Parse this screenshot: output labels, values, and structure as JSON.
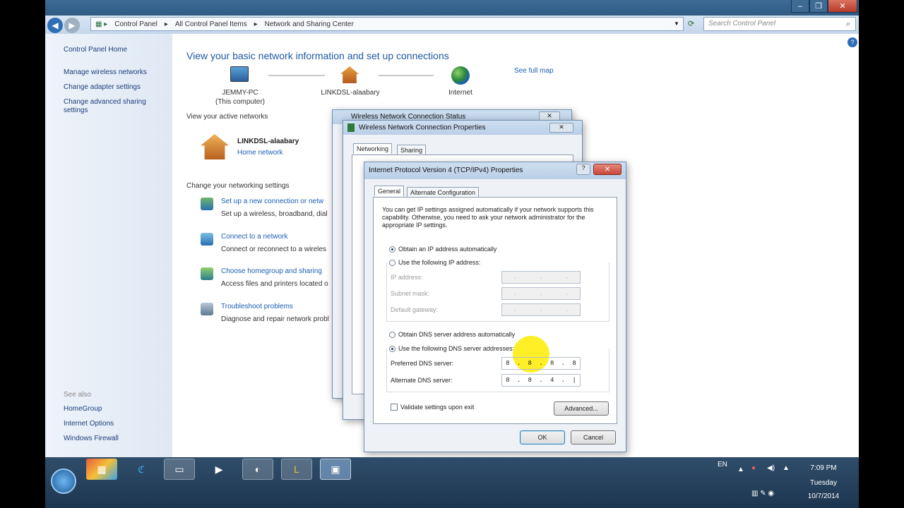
{
  "address_bar": {
    "breadcrumb": [
      "Control Panel",
      "All Control Panel Items",
      "Network and Sharing Center"
    ],
    "search_placeholder": "Search Control Panel"
  },
  "left_pane": {
    "home": "Control Panel Home",
    "links": [
      "Manage wireless networks",
      "Change adapter settings",
      "Change advanced sharing settings"
    ],
    "see_also_head": "See also",
    "see_also": [
      "HomeGroup",
      "Internet Options",
      "Windows Firewall"
    ]
  },
  "main": {
    "title": "View your basic network information and set up connections",
    "map": {
      "computer_name": "JEMMY-PC",
      "computer_sub": "(This computer)",
      "network_name": "LINKDSL-alaabary",
      "internet": "Internet",
      "see_full_map": "See full map"
    },
    "active_networks_head": "View your active networks",
    "active_network": {
      "name": "LINKDSL-alaabary",
      "type": "Home network"
    },
    "change_settings_head": "Change your networking settings",
    "tasks": [
      {
        "title": "Set up a new connection or netw",
        "sub": "Set up a wireless, broadband, dial"
      },
      {
        "title": "Connect to a network",
        "sub": "Connect or reconnect to a wireles"
      },
      {
        "title": "Choose homegroup and sharing",
        "sub": "Access files and printers located o"
      },
      {
        "title": "Troubleshoot problems",
        "sub": "Diagnose and repair network probl"
      }
    ]
  },
  "status_dialog": {
    "title": "Wireless Network Connection Status"
  },
  "properties_dialog": {
    "title": "Wireless Network Connection Properties",
    "tabs": [
      "Networking",
      "Sharing"
    ]
  },
  "ipv4_dialog": {
    "title": "Internet Protocol Version 4 (TCP/IPv4) Properties",
    "tabs": [
      "General",
      "Alternate Configuration"
    ],
    "intro": "You can get IP settings assigned automatically if your network supports this capability. Otherwise, you need to ask your network administrator for the appropriate IP settings.",
    "ip_auto": "Obtain an IP address automatically",
    "ip_manual": "Use the following IP address:",
    "ip_address_label": "IP address:",
    "subnet_label": "Subnet mask:",
    "gateway_label": "Default gateway:",
    "dns_auto": "Obtain DNS server address automatically",
    "dns_manual": "Use the following DNS server addresses:",
    "preferred_dns_label": "Preferred DNS server:",
    "preferred_dns": [
      "8",
      "8",
      "8",
      "8"
    ],
    "alternate_dns_label": "Alternate DNS server:",
    "alternate_dns": [
      "8",
      "8",
      "4",
      ""
    ],
    "validate": "Validate settings upon exit",
    "advanced": "Advanced...",
    "ok": "OK",
    "cancel": "Cancel"
  },
  "tray": {
    "lang": "EN",
    "time": "7:09 PM",
    "day": "Tuesday",
    "date": "10/7/2014"
  }
}
